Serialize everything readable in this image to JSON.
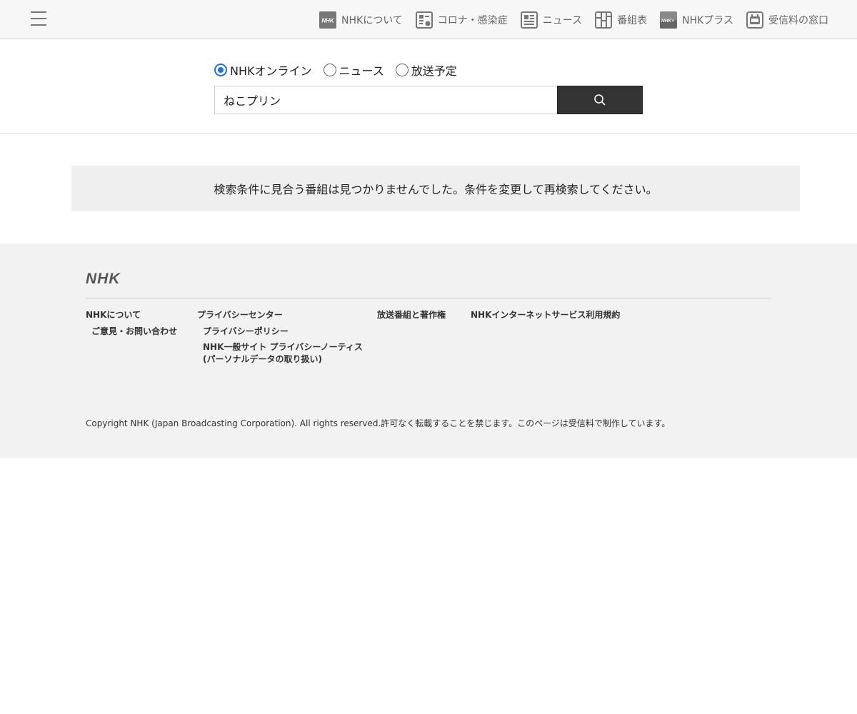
{
  "header": {
    "nav": [
      {
        "label": "NHKについて",
        "icon": "nhk-logo-icon"
      },
      {
        "label": "コロナ・感染症",
        "icon": "corona-icon"
      },
      {
        "label": "ニュース",
        "icon": "news-icon"
      },
      {
        "label": "番組表",
        "icon": "program-table-icon"
      },
      {
        "label": "NHKプラス",
        "icon": "nhk-plus-icon"
      },
      {
        "label": "受信料の窓口",
        "icon": "reception-fee-icon"
      }
    ]
  },
  "search": {
    "options": [
      {
        "label": "NHKオンライン",
        "checked": true
      },
      {
        "label": "ニュース",
        "checked": false
      },
      {
        "label": "放送予定",
        "checked": false
      }
    ],
    "query": "ねこプリン"
  },
  "message": "検索条件に見合う番組は見つかりませんでした。条件を変更して再検索してください。",
  "footer": {
    "logo": "NHK",
    "columns": [
      {
        "title": "NHKについて",
        "links": [
          "ご意見・お問い合わせ"
        ]
      },
      {
        "title": "プライバシーセンター",
        "links": [
          "プライバシーポリシー",
          "NHK一般サイト プライバシーノーティス\n(パーソナルデータの取り扱い)"
        ]
      },
      {
        "title": "放送番組と著作権",
        "links": []
      },
      {
        "title": "NHKインターネットサービス利用規約",
        "links": []
      }
    ],
    "copyright": "Copyright NHK (Japan Broadcasting Corporation). All rights reserved.許可なく転載することを禁じます。このページは受信料で制作しています。"
  },
  "colors": {
    "radio_accent": "#1a73e8",
    "search_button": "#333333",
    "footer_bg": "#f2f2f2"
  }
}
